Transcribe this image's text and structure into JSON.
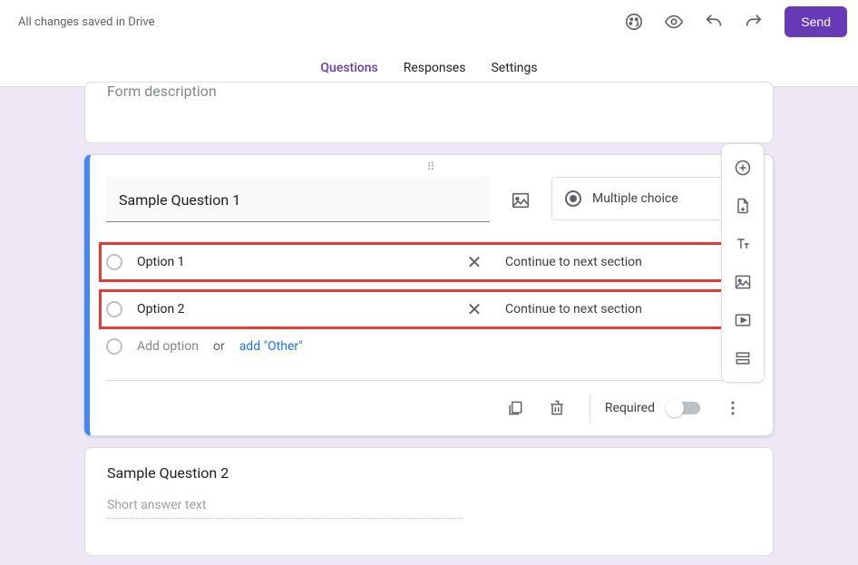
{
  "topbar": {
    "save_status": "All changes saved in Drive",
    "send_label": "Send"
  },
  "tabs": {
    "questions": "Questions",
    "responses": "Responses",
    "settings": "Settings",
    "active": "questions"
  },
  "header_card": {
    "description_placeholder": "Form description"
  },
  "q1": {
    "title": "Sample Question 1",
    "type_label": "Multiple choice",
    "options": [
      {
        "label": "Option 1",
        "goto": "Continue to next section"
      },
      {
        "label": "Option 2",
        "goto": "Continue to next section"
      }
    ],
    "add_option_placeholder": "Add option",
    "or_text": "or",
    "add_other_label": "add \"Other\"",
    "required_label": "Required",
    "required": false
  },
  "q2": {
    "title": "Sample Question 2",
    "short_answer_placeholder": "Short answer text"
  },
  "icons": {
    "palette": "palette-icon",
    "preview": "eye-icon",
    "undo": "undo-icon",
    "redo": "redo-icon",
    "image": "image-icon",
    "remove": "close-icon",
    "duplicate": "copy-icon",
    "delete": "trash-icon",
    "more": "more-vert-icon"
  },
  "sidebar": {
    "add_question": "add-circle-icon",
    "import": "import-doc-icon",
    "add_title": "text-icon",
    "add_image": "image-icon",
    "add_video": "play-icon",
    "add_section": "section-icon"
  }
}
